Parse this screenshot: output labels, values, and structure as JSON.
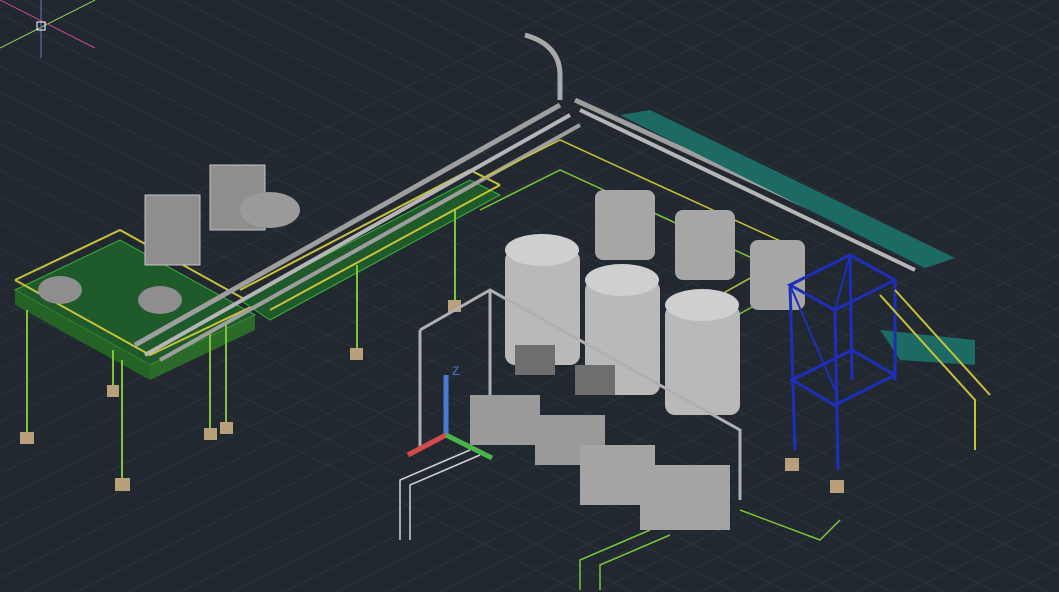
{
  "viewport": {
    "background": "#212830",
    "grid_color": "#2b333c",
    "ucs_label": "Z"
  },
  "colors": {
    "pipe_gray": "#a9a9a9",
    "equipment_gray": "#bcbcbc",
    "railing_yellow": "#c8c23a",
    "grating_green": "#2f7a2a",
    "line_green": "#7fc43a",
    "steel_blue": "#1d2fb8",
    "cable_tray_teal": "#1b6a63",
    "footing_tan": "#b8a07a",
    "axis_x_red": "#d24a4a",
    "axis_y_green": "#4ab24a",
    "axis_z_blue": "#4a7ad2"
  },
  "icons": {
    "crosshair": "cursor-crosshair-icon",
    "ucs": "ucs-axis-icon"
  }
}
